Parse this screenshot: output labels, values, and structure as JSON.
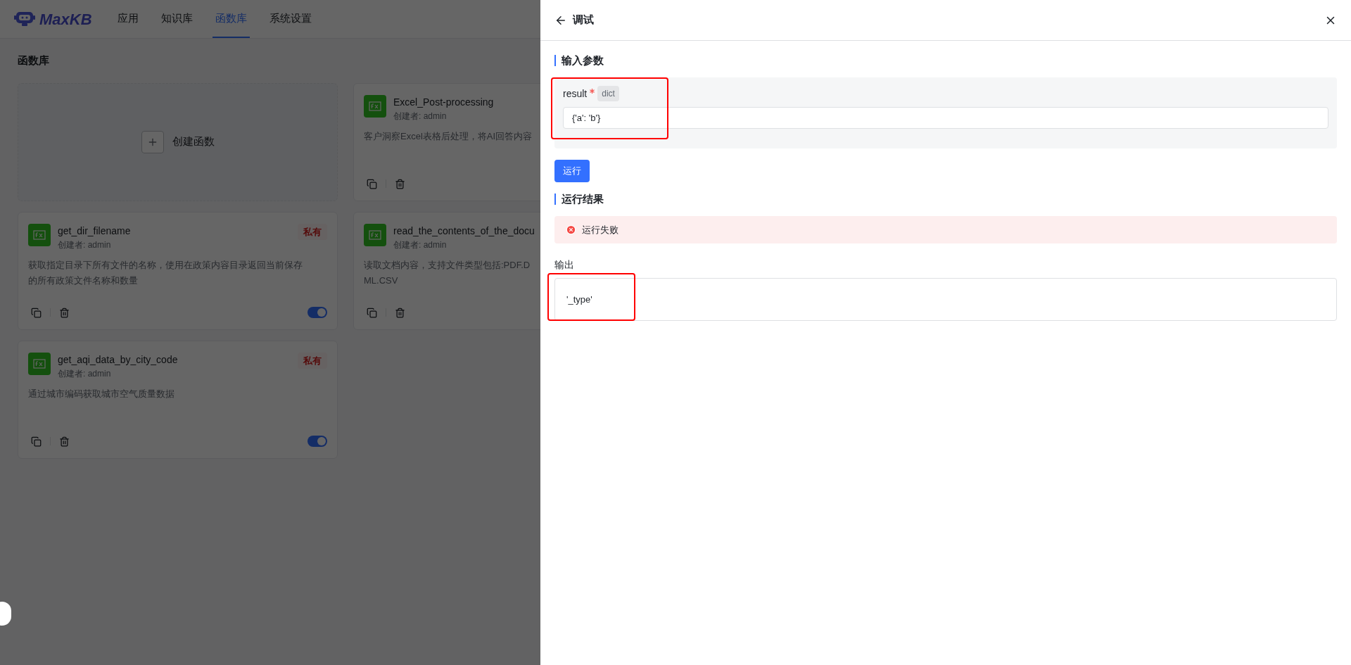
{
  "app": {
    "logo": "MaxKB",
    "nav": [
      {
        "label": "应用",
        "selected": false
      },
      {
        "label": "知识库",
        "selected": false
      },
      {
        "label": "函数库",
        "selected": true
      },
      {
        "label": "系统设置",
        "selected": false
      }
    ]
  },
  "page": {
    "title": "函数库",
    "create_label": "创建函数",
    "cards": [
      {
        "name": "Excel_Post-processing",
        "author": "创建者: admin",
        "lines": [
          "客户洞察Excel表格后处理，将AI回答内容"
        ]
      },
      {
        "name": "get_dir_filename",
        "author": "创建者: admin",
        "tag": "私有",
        "lines": [
          "获取指定目录下所有文件的名称，使用在政策内容目录返回当前保存",
          "的所有政策文件名称和数量"
        ],
        "switch_on": true
      },
      {
        "name": "read_the_contents_of_the_docu",
        "author": "创建者: admin",
        "lines": [
          "读取文档内容，支持文件类型包括:PDF.D",
          "ML.CSV"
        ]
      },
      {
        "name": "get_aqi_data_by_city_code",
        "author": "创建者: admin",
        "tag": "私有",
        "lines": [
          "通过城市编码获取城市空气质量数据"
        ],
        "switch_on": true
      }
    ]
  },
  "drawer": {
    "title": "调试",
    "input_section": "输入参数",
    "params": [
      {
        "name": "result",
        "required": true,
        "type": "dict",
        "value": "{'a': 'b'}"
      }
    ],
    "run_button": "运行",
    "result_section": "运行结果",
    "status": {
      "kind": "error",
      "text": "运行失败"
    },
    "output_label": "输出",
    "output": "'_type'"
  }
}
